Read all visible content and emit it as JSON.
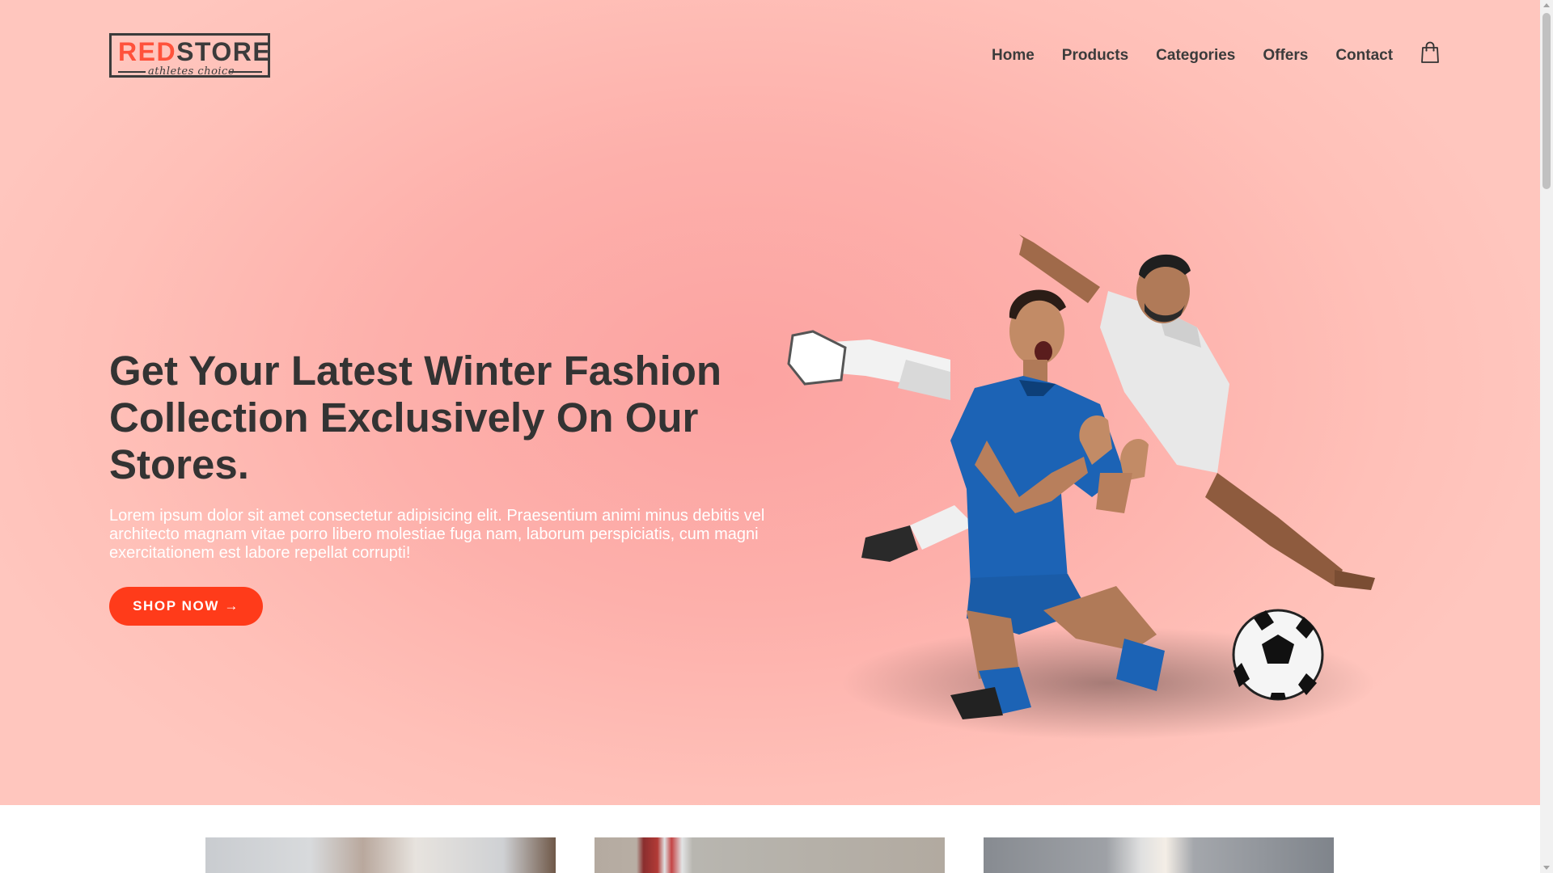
{
  "logo": {
    "red": "RED",
    "dark": "STORE",
    "tagline": "athletes choice"
  },
  "nav": {
    "items": [
      "Home",
      "Products",
      "Categories",
      "Offers",
      "Contact"
    ],
    "cart_icon": "shopping-bag-icon"
  },
  "hero": {
    "headline": "Get Your Latest Winter Fashion Collection Exclusively On Our Stores.",
    "description": "Lorem ipsum dolor sit amet consectetur adipisicing elit. Praesentium animi minus debitis vel architecto magnam vitae porro libero molestiae fuga nam, laborum perspiciatis, cum magni exercitationem est labore repellat corrupti!",
    "button_label": "SHOP NOW →",
    "image_subject": "football-players-image"
  },
  "colors": {
    "accent": "#ff523b",
    "button": "#ff3b1a",
    "text_dark": "#333333",
    "hero_bg": "#ffb6b0"
  }
}
